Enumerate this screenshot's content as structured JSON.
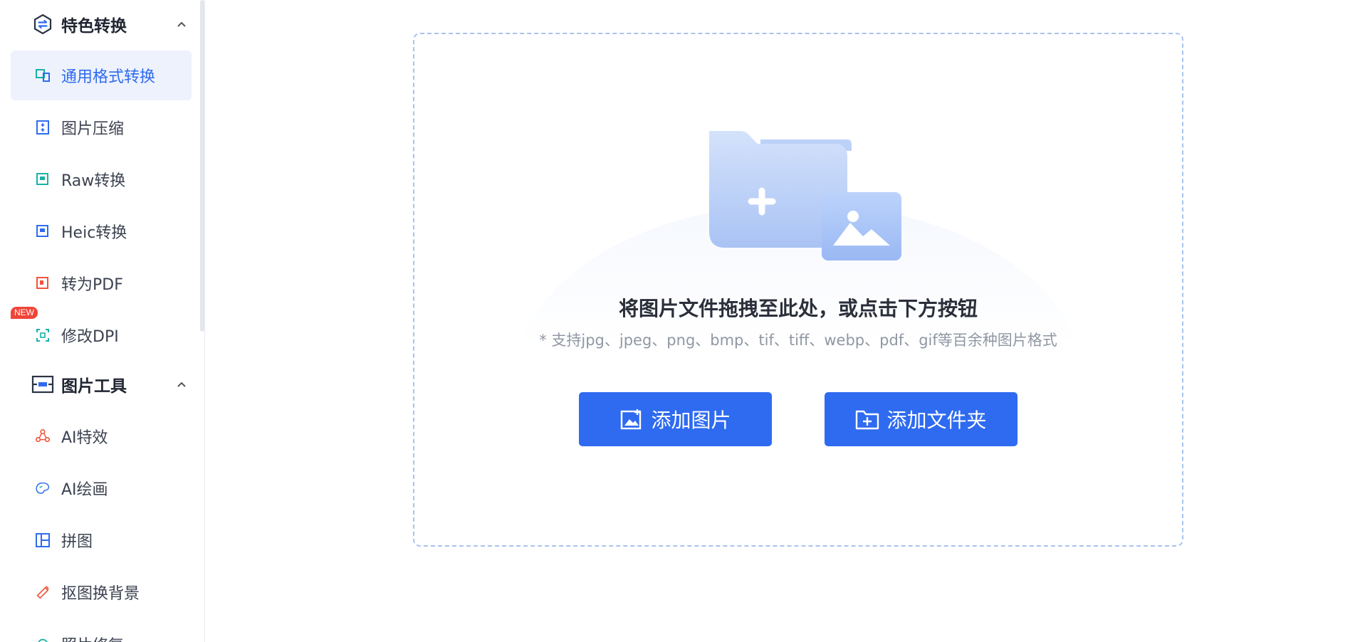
{
  "sidebar": {
    "groups": [
      {
        "label": "特色转换",
        "icon": "convert-icon",
        "expanded": true
      },
      {
        "label": "图片工具",
        "icon": "image-tools-icon",
        "expanded": true
      }
    ],
    "items": [
      {
        "label": "通用格式转换",
        "icon": "format-convert-icon",
        "active": true
      },
      {
        "label": "图片压缩",
        "icon": "compress-icon"
      },
      {
        "label": "Raw转换",
        "icon": "raw-icon"
      },
      {
        "label": "Heic转换",
        "icon": "heic-icon"
      },
      {
        "label": "转为PDF",
        "icon": "pdf-icon"
      },
      {
        "label": "修改DPI",
        "icon": "dpi-icon",
        "badge": "NEW"
      },
      {
        "label": "AI特效",
        "icon": "ai-effect-icon"
      },
      {
        "label": "AI绘画",
        "icon": "ai-paint-icon"
      },
      {
        "label": "拼图",
        "icon": "collage-icon"
      },
      {
        "label": "抠图换背景",
        "icon": "cutout-icon"
      },
      {
        "label": "照片修复",
        "icon": "repair-icon"
      }
    ]
  },
  "dropzone": {
    "title": "将图片文件拖拽至此处，或点击下方按钮",
    "subtitle": "* 支持jpg、jpeg、png、bmp、tif、tiff、webp、pdf、gif等百余种图片格式",
    "add_image_label": "添加图片",
    "add_folder_label": "添加文件夹"
  },
  "colors": {
    "accent": "#2f6bf0",
    "active_bg": "#edf2fd",
    "badge": "#f04438"
  }
}
